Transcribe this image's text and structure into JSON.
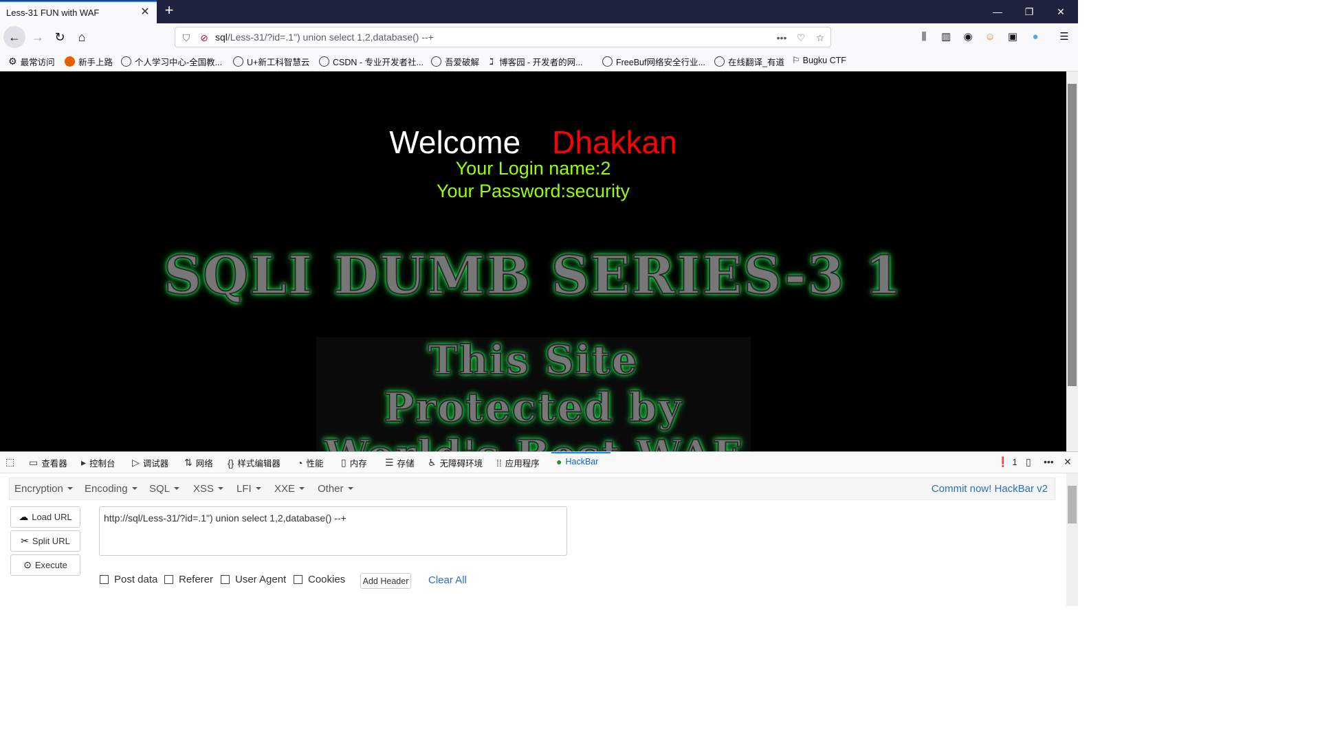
{
  "browser": {
    "tab_title": "Less-31 FUN with WAF",
    "tab_close": "✕",
    "new_tab": "+",
    "url_host": "sql",
    "url_rest": "/Less-31/?id=.1\") union select 1,2,database() --+",
    "url_more": "•••"
  },
  "bookmarks": [
    {
      "label": "最常访问"
    },
    {
      "label": "新手上路"
    },
    {
      "label": "个人学习中心-全国教..."
    },
    {
      "label": "U+新工科智慧云"
    },
    {
      "label": "CSDN - 专业开发者社..."
    },
    {
      "label": "吾爱破解"
    },
    {
      "label": "博客园 - 开发者的网..."
    },
    {
      "label": "FreeBuf网络安全行业..."
    },
    {
      "label": "在线翻译_有道"
    },
    {
      "label": "Bugku CTF"
    }
  ],
  "page": {
    "welcome": "Welcome",
    "name": "Dhakkan",
    "login_name": "Your Login name:2",
    "password": "Your Password:security",
    "banner": "SQLI DUMB SERIES-3 1",
    "waf_line1": "This Site",
    "waf_line2": "Protected by",
    "waf_line3": "World's Best WAF"
  },
  "devtools": {
    "tabs": [
      "查看器",
      "控制台",
      "调试器",
      "网络",
      "样式编辑器",
      "性能",
      "内存",
      "存储",
      "无障碍环境",
      "应用程序",
      "HackBar"
    ],
    "error_count": "1"
  },
  "hackbar": {
    "menus": [
      "Encryption",
      "Encoding",
      "SQL",
      "XSS",
      "LFI",
      "XXE",
      "Other"
    ],
    "commit": "Commit now! HackBar v2",
    "load_url": "Load URL",
    "split_url": "Split URL",
    "execute": "Execute",
    "url_value": "http://sql/Less-31/?id=.1\") union select 1,2,database() --+",
    "checks": [
      "Post data",
      "Referer",
      "User Agent",
      "Cookies"
    ],
    "add_header": "Add Header",
    "clear_all": "Clear All"
  }
}
